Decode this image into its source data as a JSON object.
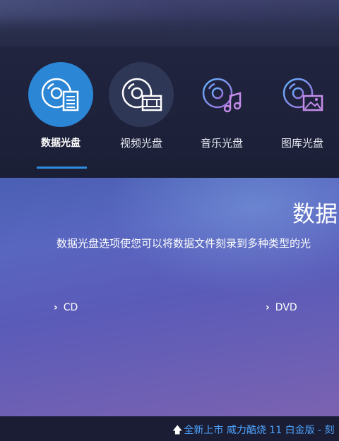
{
  "nav": {
    "items": [
      {
        "label": "数据光盘",
        "icon": "data-disc-icon"
      },
      {
        "label": "视频光盘",
        "icon": "video-disc-icon"
      },
      {
        "label": "音乐光盘",
        "icon": "music-disc-icon"
      },
      {
        "label": "图库光盘",
        "icon": "photo-disc-icon"
      }
    ],
    "active_index": 0
  },
  "content": {
    "title": "数据",
    "description": "数据光盘选项使您可以将数据文件刻录到多种类型的光",
    "links": [
      {
        "label": "CD"
      },
      {
        "label": "DVD"
      }
    ]
  },
  "footer": {
    "promo_text": "全新上市 威力酷烧 11 白金版 - 刻"
  },
  "colors": {
    "accent": "#2b86d6",
    "link": "#4da3ff"
  }
}
